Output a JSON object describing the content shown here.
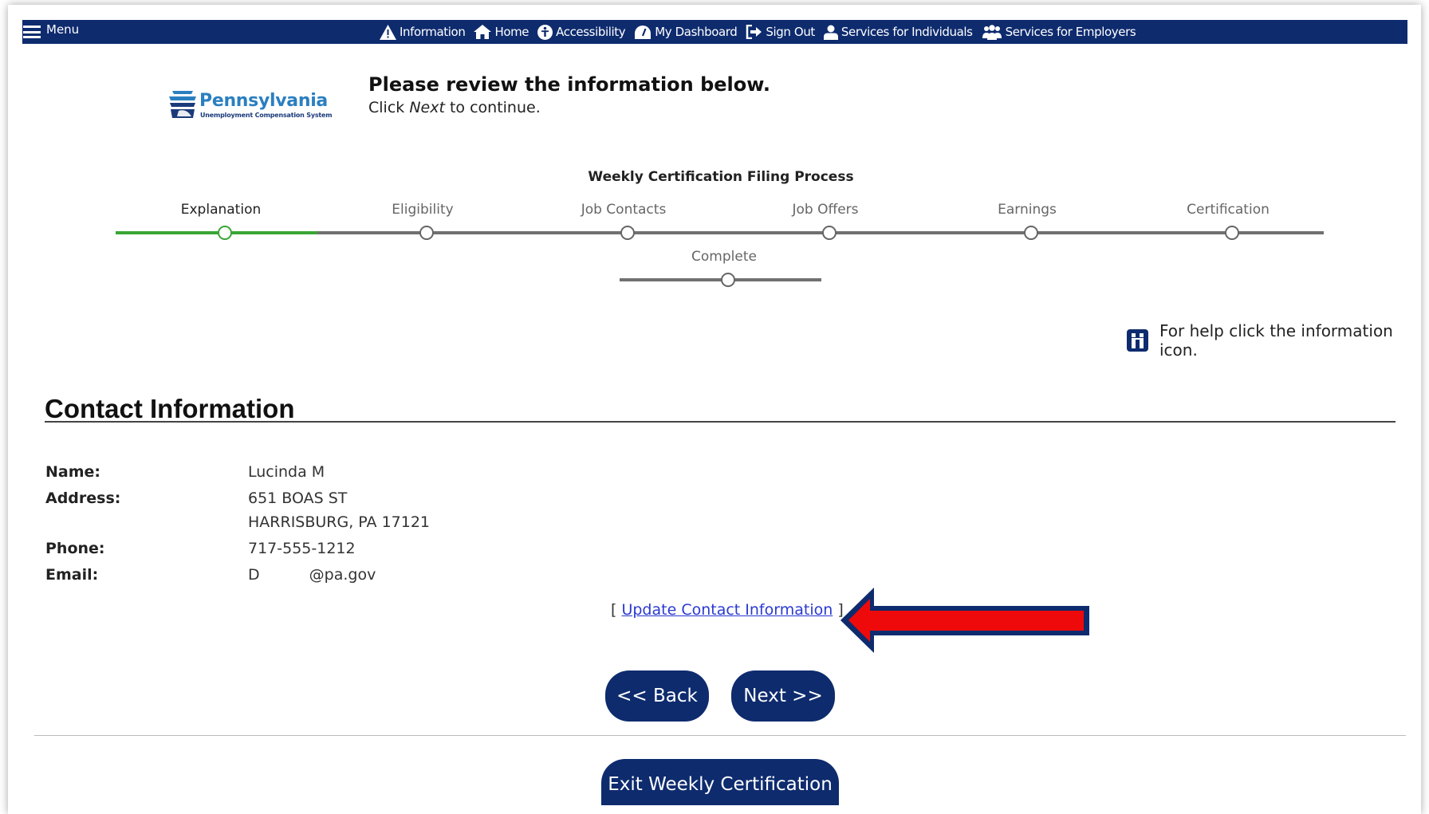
{
  "topbar": {
    "menu_label": "Menu",
    "nav": [
      {
        "icon": "warning-icon",
        "label": "Information"
      },
      {
        "icon": "home-icon",
        "label": "Home"
      },
      {
        "icon": "accessibility-icon",
        "label": "Accessibility"
      },
      {
        "icon": "dashboard-icon",
        "label": "My Dashboard"
      },
      {
        "icon": "sign-out-icon",
        "label": "Sign Out"
      },
      {
        "icon": "person-icon",
        "label": "Services for Individuals"
      },
      {
        "icon": "group-icon",
        "label": "Services for Employers"
      }
    ],
    "bg_color": "#0e2b6e"
  },
  "logo": {
    "name": "Pennsylvania",
    "subtitle": "Unemployment Compensation System"
  },
  "header": {
    "title": "Please review the information below.",
    "subtitle_before": "Click ",
    "subtitle_em": "Next",
    "subtitle_after": " to continue."
  },
  "process": {
    "title": "Weekly Certification Filing Process",
    "current_step": "Explanation",
    "steps": [
      "Explanation",
      "Eligibility",
      "Job Contacts",
      "Job Offers",
      "Earnings",
      "Certification",
      "Complete"
    ],
    "active_color": "#3aa535"
  },
  "help": {
    "text": "For help click the information icon."
  },
  "contact": {
    "section_title": "Contact Information",
    "fields": [
      {
        "label": "Name:",
        "value": "Lucinda M"
      },
      {
        "label": "Address:",
        "value": "651 BOAS ST",
        "value2": "HARRISBURG, PA 17121"
      },
      {
        "label": "Phone:",
        "value": "717-555-1212"
      },
      {
        "label": "Email:",
        "value": "D",
        "value_suffix": "@pa.gov"
      }
    ],
    "update_link": "Update Contact Information",
    "bracket_open": "[",
    "bracket_close": "]"
  },
  "buttons": {
    "back": "<< Back",
    "next": "Next >>",
    "exit": "Exit Weekly Certification"
  },
  "annotation": {
    "arrow_color": "#ee0a0a"
  }
}
